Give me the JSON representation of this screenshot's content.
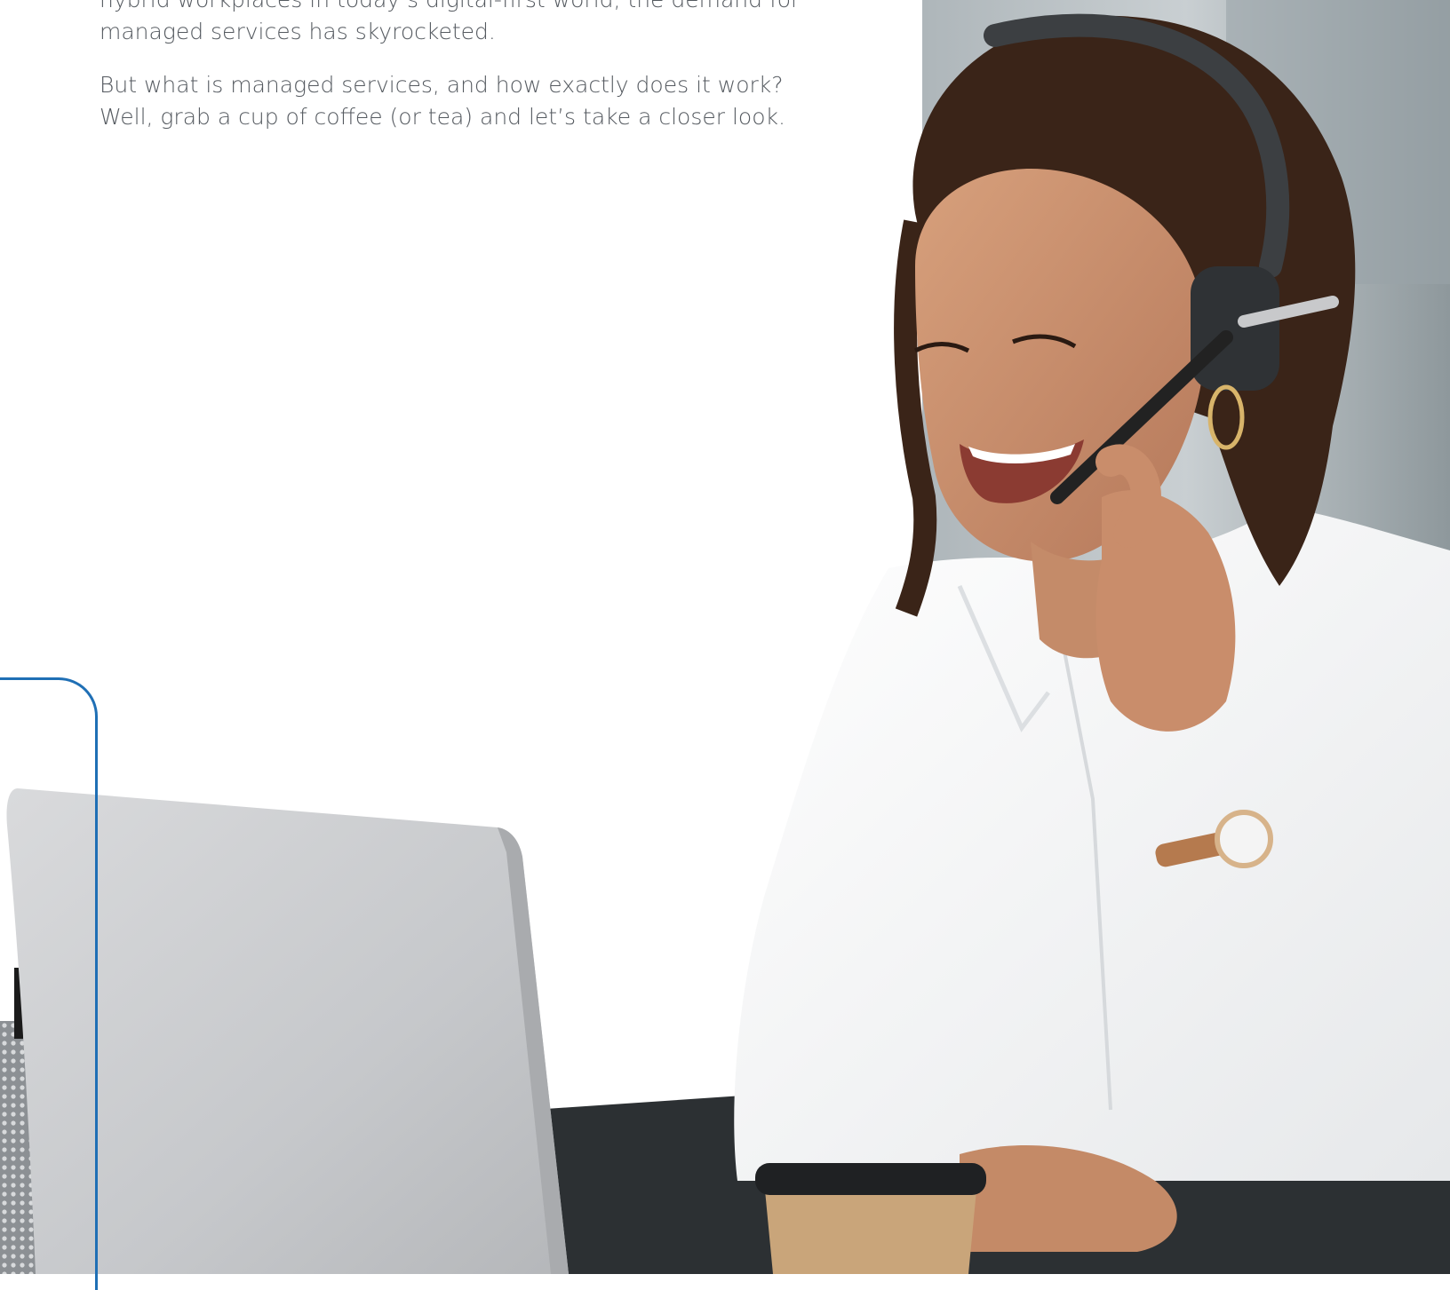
{
  "intro": {
    "paragraph_1_line_1": "hybrid workplaces in today’s digital-first world, the demand for",
    "paragraph_1_line_2": "managed services has skyrocketed.",
    "paragraph_2_line_1": "But what is managed services, and how exactly does it work?",
    "paragraph_2_line_2": "Well, grab a cup of coffee (or tea) and let’s take a closer look."
  },
  "colors": {
    "accent": "#1f6fb5",
    "body_text": "#555a60",
    "background": "#ffffff"
  }
}
